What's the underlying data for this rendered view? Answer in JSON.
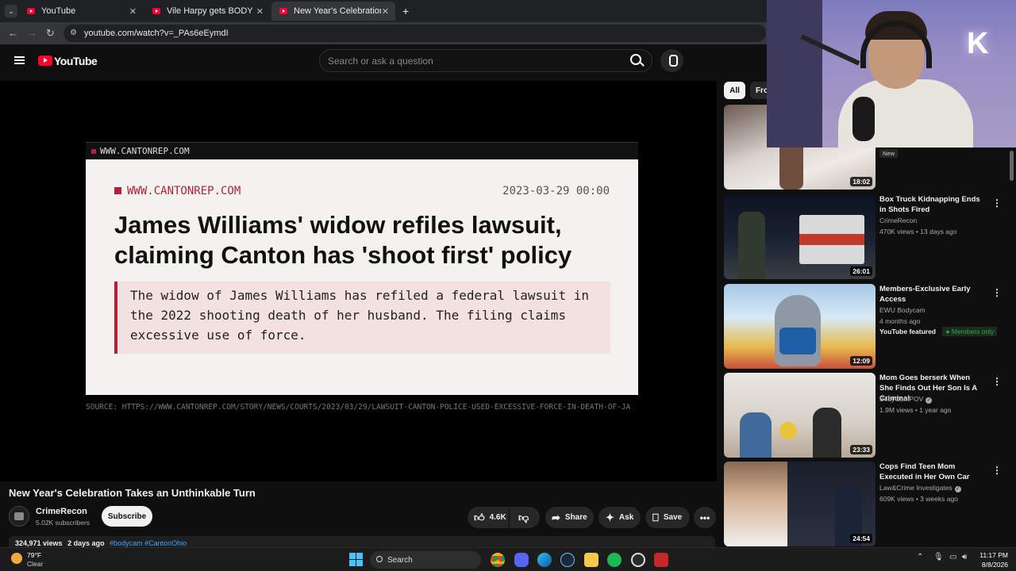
{
  "browser": {
    "tabs": [
      {
        "title": "YouTube"
      },
      {
        "title": "Vile Harpy gets BODY SLAMMED"
      },
      {
        "title": "New Year's Celebration Takes an"
      }
    ],
    "new_tab": "+",
    "url": "youtube.com/watch?v=_PAs6eEymdI"
  },
  "youtube": {
    "logo_text": "YouTube",
    "search_placeholder": "Search or ask a question"
  },
  "video_frame": {
    "top_site": "WWW.CANTONREP.COM",
    "card_site": "WWW.CANTONREP.COM",
    "card_date": "2023-03-29 00:00",
    "headline": "James Williams' widow refiles lawsuit, claiming Canton has 'shoot first' policy",
    "quote": "The widow of James Williams has refiled a federal lawsuit in the 2022 shooting death of her husband. The filing claims excessive use of force.",
    "source": "SOURCE: HTTPS://WWW.CANTONREP.COM/STORY/NEWS/COURTS/2023/03/29/LAWSUIT-CANTON-POLICE-USED-EXCESSIVE-FORCE-IN-DEATH-OF-JA"
  },
  "video": {
    "title": "New Year's Celebration Takes an Unthinkable Turn",
    "channel": "CrimeRecon",
    "subscribers": "5.02K subscribers",
    "subscribe_label": "Subscribe",
    "likes": "4.6K",
    "share_label": "Share",
    "ask_label": "Ask",
    "save_label": "Save",
    "desc_views": "324,971 views",
    "desc_age": "2 days ago",
    "desc_tags": "#bodycam #CantonOhio"
  },
  "chips": {
    "all": "All",
    "from": "Fro"
  },
  "recommendations": [
    {
      "title": "",
      "channel": "",
      "views": "",
      "age": "",
      "badge": "New",
      "duration": "18:02"
    },
    {
      "title": "Box Truck Kidnapping Ends in Shots Fired",
      "channel": "CrimeRecon",
      "views": "470K views",
      "age": "13 days ago",
      "duration": "26:01"
    },
    {
      "title": "Members-Exclusive Early Access",
      "channel": "EWU Bodycam",
      "meta": "4 months ago",
      "featured": "YouTube featured",
      "members": "Members only",
      "duration": "12:09"
    },
    {
      "title": "Mom Goes berserk When She Finds Out Her Son Is A Criminal",
      "channel": "BodyCamPOV",
      "views": "1.9M views",
      "age": "1 year ago",
      "duration": "23:33"
    },
    {
      "title": "Cops Find Teen Mom Executed in Her Own Car",
      "channel": "Law&Crime Investigates",
      "views": "609K views",
      "age": "3 weeks ago",
      "duration": "24:54"
    }
  ],
  "taskbar": {
    "temp": "79°F",
    "condition": "Clear",
    "search": "Search",
    "time": "11:17 PM",
    "date": "8/8/2026"
  },
  "colors": {
    "accent_red": "#ff0033",
    "quote_border": "#b0213a",
    "link_blue": "#3ea6ff",
    "members_green": "#2ba640"
  }
}
